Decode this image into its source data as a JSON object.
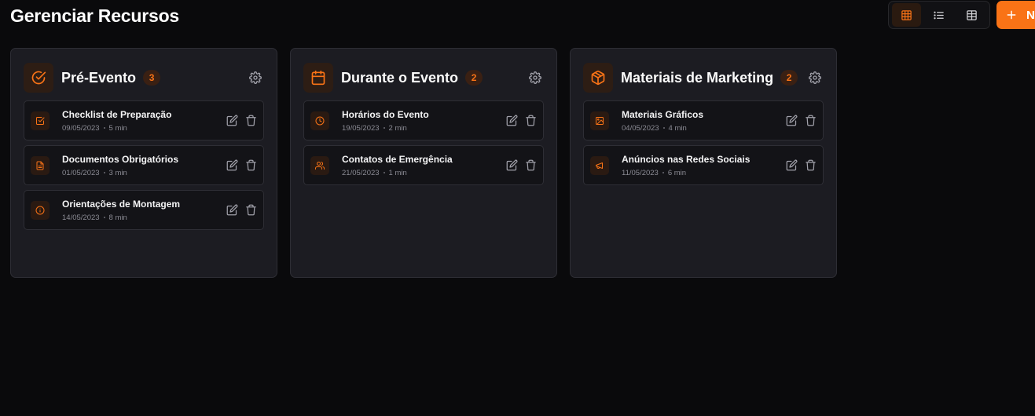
{
  "header": {
    "title": "Gerenciar Recursos",
    "new_button_label": "N",
    "view_modes": [
      {
        "name": "grid-view",
        "active": true
      },
      {
        "name": "list-view",
        "active": false
      },
      {
        "name": "table-view",
        "active": false
      }
    ]
  },
  "colors": {
    "accent": "#f97316",
    "background": "#0a0a0c",
    "card": "#1c1c22"
  },
  "columns": [
    {
      "title": "Pré-Evento",
      "count": "3",
      "icon": "check-circle-icon",
      "items": [
        {
          "title": "Checklist de Preparação",
          "date": "09/05/2023",
          "duration": "5 min",
          "icon": "checkbox-icon"
        },
        {
          "title": "Documentos Obrigatórios",
          "date": "01/05/2023",
          "duration": "3 min",
          "icon": "document-icon"
        },
        {
          "title": "Orientações de Montagem",
          "date": "14/05/2023",
          "duration": "8 min",
          "icon": "info-icon"
        }
      ]
    },
    {
      "title": "Durante o Evento",
      "count": "2",
      "icon": "calendar-icon",
      "items": [
        {
          "title": "Horários do Evento",
          "date": "19/05/2023",
          "duration": "2 min",
          "icon": "clock-icon"
        },
        {
          "title": "Contatos de Emergência",
          "date": "21/05/2023",
          "duration": "1 min",
          "icon": "users-icon"
        }
      ]
    },
    {
      "title": "Materiais de Marketing",
      "count": "2",
      "icon": "package-icon",
      "items": [
        {
          "title": "Materiais Gráficos",
          "date": "04/05/2023",
          "duration": "4 min",
          "icon": "image-icon"
        },
        {
          "title": "Anúncios nas Redes Sociais",
          "date": "11/05/2023",
          "duration": "6 min",
          "icon": "megaphone-icon"
        }
      ]
    }
  ]
}
